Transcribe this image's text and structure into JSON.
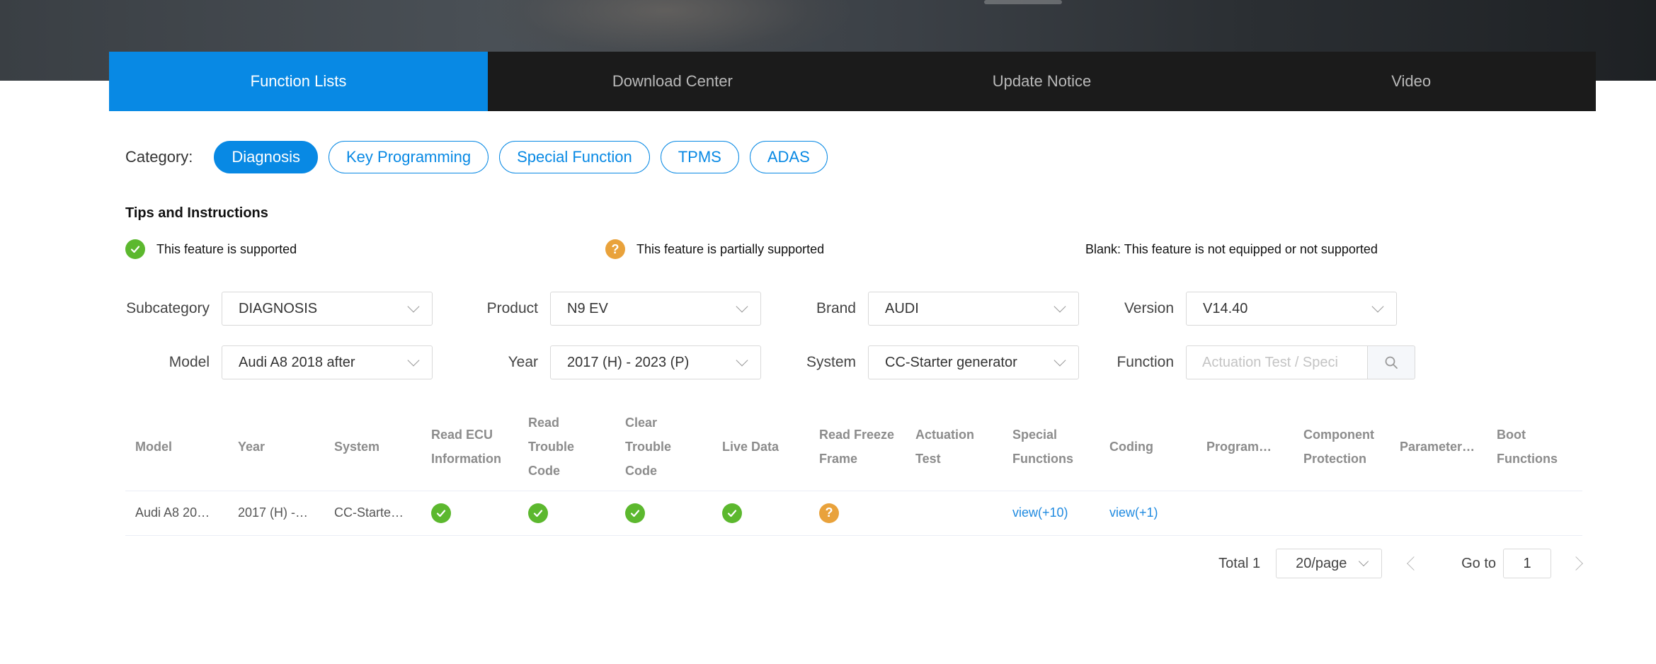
{
  "tabs": [
    {
      "label": "Function Lists",
      "active": true
    },
    {
      "label": "Download Center",
      "active": false
    },
    {
      "label": "Update Notice",
      "active": false
    },
    {
      "label": "Video",
      "active": false
    }
  ],
  "category": {
    "label": "Category:",
    "items": [
      {
        "label": "Diagnosis",
        "active": true
      },
      {
        "label": "Key Programming",
        "active": false
      },
      {
        "label": "Special Function",
        "active": false
      },
      {
        "label": "TPMS",
        "active": false
      },
      {
        "label": "ADAS",
        "active": false
      }
    ]
  },
  "tips": {
    "title": "Tips and Instructions",
    "supported": "This feature is supported",
    "partial": "This feature is partially supported",
    "blank": "Blank: This feature is not equipped or not supported",
    "partial_glyph": "?"
  },
  "filters": {
    "subcategory": {
      "label": "Subcategory",
      "value": "DIAGNOSIS"
    },
    "product": {
      "label": "Product",
      "value": "N9 EV"
    },
    "brand": {
      "label": "Brand",
      "value": "AUDI"
    },
    "version": {
      "label": "Version",
      "value": "V14.40"
    },
    "model": {
      "label": "Model",
      "value": "Audi A8 2018 after"
    },
    "year": {
      "label": "Year",
      "value": "2017 (H) - 2023 (P)"
    },
    "system": {
      "label": "System",
      "value": "CC-Starter generator"
    },
    "function": {
      "label": "Function",
      "placeholder": "Actuation Test / Speci"
    }
  },
  "table": {
    "headers": [
      "Model",
      "Year",
      "System",
      "Read ECU Information",
      "Read Trouble Code",
      "Clear Trouble Code",
      "Live Data",
      "Read Freeze Frame",
      "Actuation Test",
      "Special Functions",
      "Coding",
      "Program…",
      "Component Protection",
      "Parameter…",
      "Boot Functions"
    ],
    "rows": [
      {
        "model": "Audi A8 20…",
        "year": "2017 (H) -…",
        "system": "CC-Starte…",
        "special": "view(+10)",
        "coding": "view(+1)"
      }
    ]
  },
  "pagination": {
    "total": "Total 1",
    "page_size": "20/page",
    "goto_label": "Go to",
    "goto_value": "1"
  },
  "colors": {
    "accent": "#0889e4",
    "supported": "#5cb82e",
    "partial": "#e9a23b",
    "tab_bar": "#1b1b1b"
  }
}
